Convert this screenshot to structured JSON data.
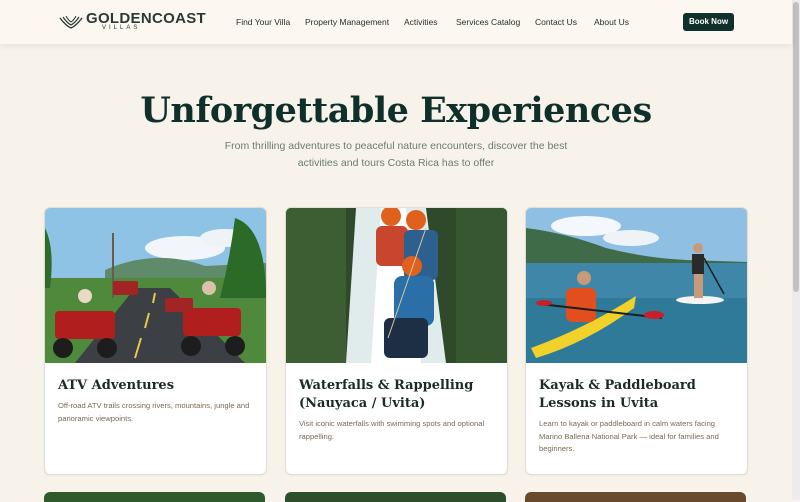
{
  "brand": {
    "name": "GOLDENCOAST",
    "sub": "VILLAS"
  },
  "nav": {
    "items": [
      {
        "label": "Find Your Villa"
      },
      {
        "label": "Property Management"
      },
      {
        "label": "Activities"
      },
      {
        "label": "Services Catalog"
      },
      {
        "label": "Contact Us"
      },
      {
        "label": "About Us"
      }
    ],
    "cta": "Book Now"
  },
  "hero": {
    "title": "Unforgettable Experiences",
    "subtitle": "From thrilling adventures to peaceful nature encounters, discover the best activities and tours Costa Rica has to offer"
  },
  "cards": [
    {
      "title": "ATV Adventures",
      "desc": "Off-road ATV trails crossing rivers, mountains, jungle and panoramic viewpoints.",
      "image": "atv-tour-photo"
    },
    {
      "title": "Waterfalls & Rappelling (Nauyaca / Uvita)",
      "desc": "Visit iconic waterfalls with swimming spots and optional rappelling.",
      "image": "waterfall-rappelling-photo"
    },
    {
      "title": "Kayak & Paddleboard Lessons in Uvita",
      "desc": "Learn to kayak or paddleboard in calm waters facing Marino Ballena National Park — ideal for families and beginners.",
      "image": "kayak-paddleboard-photo"
    }
  ],
  "colors": {
    "background": "#f8f3ea",
    "primary": "#10302b",
    "title": "#0f2f2a",
    "muted": "#6a7c73"
  }
}
